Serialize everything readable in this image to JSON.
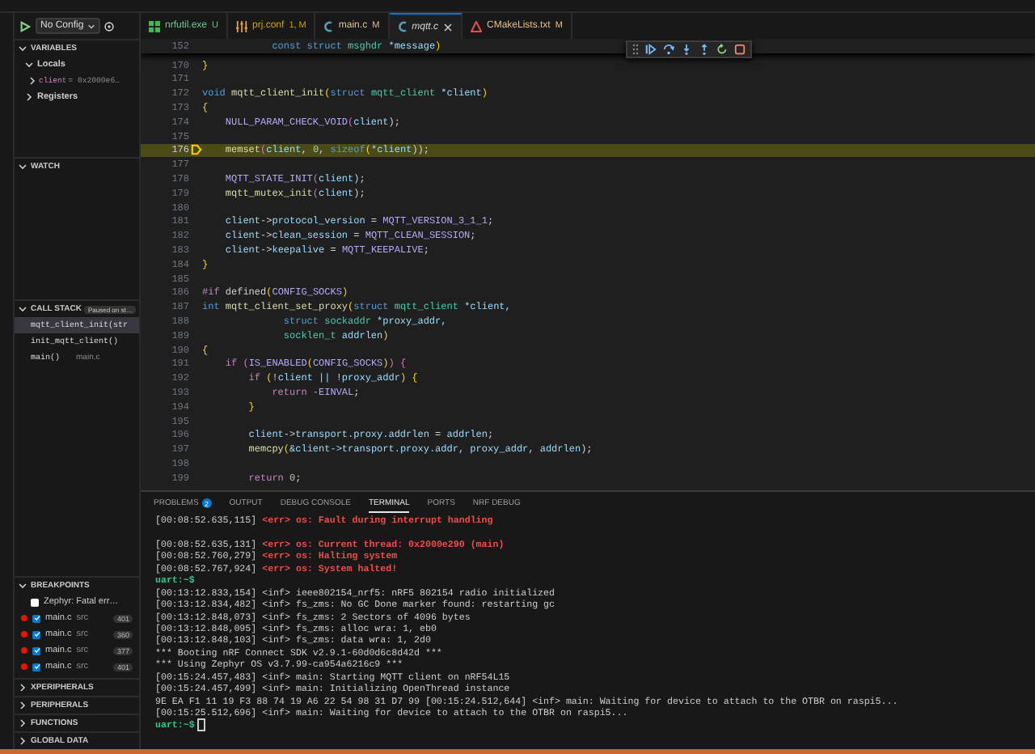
{
  "debug_toolbar": {
    "configuration": "No Config"
  },
  "variables": {
    "title": "VARIABLES",
    "expanded": true,
    "scopes": [
      {
        "label": "Locals",
        "expanded": true,
        "children": [
          {
            "name": "client",
            "value": "= 0x2000e6…",
            "expanded": false
          }
        ]
      },
      {
        "label": "Registers",
        "expanded": false
      }
    ]
  },
  "watch": {
    "title": "WATCH",
    "expanded": true
  },
  "call_stack": {
    "title": "CALL STACK",
    "expanded": true,
    "status": "Paused on st…",
    "frames": [
      {
        "name": "mqtt_client_init(str",
        "selected": true
      },
      {
        "name": "init_mqtt_client()",
        "selected": false
      },
      {
        "name": "main()",
        "source": "main.c",
        "selected": false
      }
    ]
  },
  "breakpoints": {
    "title": "BREAKPOINTS",
    "expanded": true,
    "items": [
      {
        "kind": "exception",
        "label": "Zephyr: Fatal err…",
        "checked": false
      },
      {
        "kind": "line",
        "file": "main.c",
        "folder": "src",
        "line": "401",
        "checked": true
      },
      {
        "kind": "line",
        "file": "main.c",
        "folder": "src",
        "line": "360",
        "checked": true
      },
      {
        "kind": "line",
        "file": "main.c",
        "folder": "src",
        "line": "377",
        "checked": true
      },
      {
        "kind": "line",
        "file": "main.c",
        "folder": "src",
        "line": "401",
        "checked": true
      }
    ]
  },
  "collapsed_sections": [
    {
      "title": "XPERIPHERALS",
      "expanded": false
    },
    {
      "title": "PERIPHERALS",
      "expanded": false
    },
    {
      "title": "FUNCTIONS",
      "expanded": false
    },
    {
      "title": "GLOBAL DATA",
      "expanded": false
    }
  ],
  "tabs": [
    {
      "kind": "windows",
      "label": "nrfutil.exe",
      "badge": "U",
      "color": "#73c991",
      "selected": false
    },
    {
      "kind": "settings",
      "label": "prj.conf",
      "badge": "1, M",
      "color": "#cca700",
      "selected": false
    },
    {
      "kind": "c",
      "label": "main.c",
      "badge": "M",
      "color": "#e2c08d",
      "selected": false
    },
    {
      "kind": "c",
      "label": "mqtt.c",
      "color": "#d4d4d4",
      "selected": true
    },
    {
      "kind": "cmake",
      "label": "CMakeLists.txt",
      "badge": "M",
      "color": "#e2c08d",
      "selected": false
    }
  ],
  "editor": {
    "sticky_line": {
      "number": "152",
      "tokens": [
        {
          "text": "            const struct ",
          "kind": "keyword"
        },
        {
          "text": "msghdr ",
          "kind": "type"
        },
        {
          "text": "*message",
          "kind": "variable"
        },
        {
          "text": ")",
          "kind": "bracket"
        }
      ]
    },
    "lines": [
      {
        "number": "170",
        "current": false,
        "tokens": [
          {
            "text": "}",
            "kind": "bracket"
          }
        ]
      },
      {
        "number": "171",
        "current": false
      },
      {
        "number": "172",
        "current": false,
        "tokens": [
          {
            "text": "void ",
            "kind": "keyword"
          },
          {
            "text": "mqtt_client_init",
            "kind": "function"
          },
          {
            "text": "(",
            "kind": "bracket"
          },
          {
            "text": "struct ",
            "kind": "keyword"
          },
          {
            "text": "mqtt_client ",
            "kind": "type"
          },
          {
            "text": "*client",
            "kind": "variable"
          },
          {
            "text": ")",
            "kind": "bracket"
          }
        ]
      },
      {
        "number": "173",
        "current": false,
        "tokens": [
          {
            "text": "{",
            "kind": "bracket"
          }
        ]
      },
      {
        "number": "174",
        "current": false,
        "tokens": [
          {
            "text": "    NULL_PARAM_CHECK_VOID",
            "kind": "macro"
          },
          {
            "text": "(",
            "kind": "bracket2"
          },
          {
            "text": "client",
            "kind": "variable"
          },
          {
            "text": ");",
            "kind": "plain"
          }
        ]
      },
      {
        "number": "175",
        "current": false
      },
      {
        "number": "176",
        "current": true,
        "tokens": [
          {
            "text": "    memset",
            "kind": "function"
          },
          {
            "text": "(",
            "kind": "bracket2"
          },
          {
            "text": "client",
            "kind": "variable"
          },
          {
            "text": ", ",
            "kind": "plain"
          },
          {
            "text": "0",
            "kind": "number"
          },
          {
            "text": ", ",
            "kind": "plain"
          },
          {
            "text": "sizeof",
            "kind": "keyword"
          },
          {
            "text": "(",
            "kind": "bracket"
          },
          {
            "text": "*client",
            "kind": "variable"
          },
          {
            "text": "));",
            "kind": "plain"
          }
        ]
      },
      {
        "number": "177",
        "current": false
      },
      {
        "number": "178",
        "current": false,
        "tokens": [
          {
            "text": "    MQTT_STATE_INIT",
            "kind": "macro"
          },
          {
            "text": "(",
            "kind": "bracket2"
          },
          {
            "text": "client",
            "kind": "variable"
          },
          {
            "text": ");",
            "kind": "plain"
          }
        ]
      },
      {
        "number": "179",
        "current": false,
        "tokens": [
          {
            "text": "    mqtt_mutex_init",
            "kind": "function"
          },
          {
            "text": "(",
            "kind": "bracket2"
          },
          {
            "text": "client",
            "kind": "variable"
          },
          {
            "text": ");",
            "kind": "plain"
          }
        ]
      },
      {
        "number": "180",
        "current": false
      },
      {
        "number": "181",
        "current": false,
        "tokens": [
          {
            "text": "    client",
            "kind": "variable"
          },
          {
            "text": "->",
            "kind": "plain"
          },
          {
            "text": "protocol_version",
            "kind": "variable"
          },
          {
            "text": " = ",
            "kind": "plain"
          },
          {
            "text": "MQTT_VERSION_3_1_1",
            "kind": "macro"
          },
          {
            "text": ";",
            "kind": "plain"
          }
        ]
      },
      {
        "number": "182",
        "current": false,
        "tokens": [
          {
            "text": "    client",
            "kind": "variable"
          },
          {
            "text": "->",
            "kind": "plain"
          },
          {
            "text": "clean_session",
            "kind": "variable"
          },
          {
            "text": " = ",
            "kind": "plain"
          },
          {
            "text": "MQTT_CLEAN_SESSION",
            "kind": "macro"
          },
          {
            "text": ";",
            "kind": "plain"
          }
        ]
      },
      {
        "number": "183",
        "current": false,
        "tokens": [
          {
            "text": "    client",
            "kind": "variable"
          },
          {
            "text": "->",
            "kind": "plain"
          },
          {
            "text": "keepalive",
            "kind": "variable"
          },
          {
            "text": " = ",
            "kind": "plain"
          },
          {
            "text": "MQTT_KEEPALIVE",
            "kind": "macro"
          },
          {
            "text": ";",
            "kind": "plain"
          }
        ]
      },
      {
        "number": "184",
        "current": false,
        "tokens": [
          {
            "text": "}",
            "kind": "bracket"
          }
        ]
      },
      {
        "number": "185",
        "current": false
      },
      {
        "number": "186",
        "current": false,
        "tokens": [
          {
            "text": "#if ",
            "kind": "control"
          },
          {
            "text": "defined",
            "kind": "plain"
          },
          {
            "text": "(",
            "kind": "bracket"
          },
          {
            "text": "CONFIG_SOCKS",
            "kind": "macro"
          },
          {
            "text": ")",
            "kind": "bracket"
          }
        ]
      },
      {
        "number": "187",
        "current": false,
        "tokens": [
          {
            "text": "int ",
            "kind": "keyword"
          },
          {
            "text": "mqtt_client_set_proxy",
            "kind": "function"
          },
          {
            "text": "(",
            "kind": "bracket"
          },
          {
            "text": "struct ",
            "kind": "keyword"
          },
          {
            "text": "mqtt_client ",
            "kind": "type"
          },
          {
            "text": "*client,",
            "kind": "variable"
          }
        ]
      },
      {
        "number": "188",
        "current": false,
        "tokens": [
          {
            "text": "              struct ",
            "kind": "keyword"
          },
          {
            "text": "sockaddr ",
            "kind": "type"
          },
          {
            "text": "*proxy_addr,",
            "kind": "variable"
          }
        ]
      },
      {
        "number": "189",
        "current": false,
        "tokens": [
          {
            "text": "              socklen_t ",
            "kind": "type"
          },
          {
            "text": "addrlen",
            "kind": "variable"
          },
          {
            "text": ")",
            "kind": "bracket"
          }
        ]
      },
      {
        "number": "190",
        "current": false,
        "tokens": [
          {
            "text": "{",
            "kind": "bracket"
          }
        ]
      },
      {
        "number": "191",
        "current": false,
        "tokens": [
          {
            "text": "    if ",
            "kind": "control"
          },
          {
            "text": "(",
            "kind": "bracket2"
          },
          {
            "text": "IS_ENABLED",
            "kind": "macro"
          },
          {
            "text": "(",
            "kind": "bracket"
          },
          {
            "text": "CONFIG_SOCKS",
            "kind": "macro"
          },
          {
            "text": ")",
            "kind": "bracket"
          },
          {
            "text": ") {",
            "kind": "bracket2"
          }
        ]
      },
      {
        "number": "192",
        "current": false,
        "tokens": [
          {
            "text": "        if ",
            "kind": "control"
          },
          {
            "text": "(",
            "kind": "bracket"
          },
          {
            "text": "!client || !proxy_addr",
            "kind": "variable"
          },
          {
            "text": ") {",
            "kind": "bracket"
          }
        ]
      },
      {
        "number": "193",
        "current": false,
        "tokens": [
          {
            "text": "            return ",
            "kind": "control"
          },
          {
            "text": "-EINVAL",
            "kind": "macro"
          },
          {
            "text": ";",
            "kind": "plain"
          }
        ]
      },
      {
        "number": "194",
        "current": false,
        "tokens": [
          {
            "text": "        }",
            "kind": "bracket"
          }
        ]
      },
      {
        "number": "195",
        "current": false
      },
      {
        "number": "196",
        "current": false,
        "tokens": [
          {
            "text": "        client",
            "kind": "variable"
          },
          {
            "text": "->",
            "kind": "plain"
          },
          {
            "text": "transport.proxy.addrlen",
            "kind": "variable"
          },
          {
            "text": " = ",
            "kind": "plain"
          },
          {
            "text": "addrlen",
            "kind": "variable"
          },
          {
            "text": ";",
            "kind": "plain"
          }
        ]
      },
      {
        "number": "197",
        "current": false,
        "tokens": [
          {
            "text": "        memcpy",
            "kind": "function"
          },
          {
            "text": "(",
            "kind": "bracket"
          },
          {
            "text": "&client->transport.proxy.addr, proxy_addr, addrlen",
            "kind": "variable"
          },
          {
            "text": ");",
            "kind": "plain"
          }
        ]
      },
      {
        "number": "198",
        "current": false
      },
      {
        "number": "199",
        "current": false,
        "tokens": [
          {
            "text": "        return ",
            "kind": "control"
          },
          {
            "text": "0",
            "kind": "number"
          },
          {
            "text": ";",
            "kind": "plain"
          }
        ]
      }
    ]
  },
  "panel": {
    "tabs": [
      {
        "label": "PROBLEMS",
        "badge": "2",
        "selected": false
      },
      {
        "label": "OUTPUT",
        "selected": false
      },
      {
        "label": "DEBUG CONSOLE",
        "selected": false
      },
      {
        "label": "TERMINAL",
        "selected": true
      },
      {
        "label": "PORTS",
        "selected": false
      },
      {
        "label": "NRF DEBUG",
        "selected": false
      }
    ],
    "terminal_lines": [
      {
        "kind": "error",
        "time": "[00:08:52.635,115]",
        "message": "<err> os: Fault during interrupt handling"
      },
      {
        "kind": "blank"
      },
      {
        "kind": "error",
        "time": "[00:08:52.635,131]",
        "message": "<err> os: Current thread: 0x2000e290 (main)"
      },
      {
        "kind": "error",
        "time": "[00:08:52.760,279]",
        "message": "<err> os: Halting system"
      },
      {
        "kind": "error",
        "time": "[00:08:52.767,924]",
        "message": "<err> os: System halted!"
      },
      {
        "kind": "prompt",
        "text": "uart:~$",
        "cursor": false
      },
      {
        "kind": "log",
        "text": "[00:13:12.833,154] <inf> ieee802154_nrf5: nRF5 802154 radio initialized"
      },
      {
        "kind": "log",
        "text": "[00:13:12.834,482] <inf> fs_zms: No GC Done marker found: restarting gc"
      },
      {
        "kind": "log",
        "text": "[00:13:12.848,073] <inf> fs_zms: 2 Sectors of 4096 bytes"
      },
      {
        "kind": "log",
        "text": "[00:13:12.848,095] <inf> fs_zms: alloc wra: 1, eb0"
      },
      {
        "kind": "log",
        "text": "[00:13:12.848,103] <inf> fs_zms: data wra: 1, 2d0"
      },
      {
        "kind": "log",
        "text": "*** Booting nRF Connect SDK v2.9.1-60d0d6c8d42d ***"
      },
      {
        "kind": "log",
        "text": "*** Using Zephyr OS v3.7.99-ca954a6216c9 ***"
      },
      {
        "kind": "log",
        "text": "[00:15:24.457,483] <inf> main: Starting MQTT client on nRF54L15"
      },
      {
        "kind": "log",
        "text": "[00:15:24.457,499] <inf> main: Initializing OpenThread instance"
      },
      {
        "kind": "log",
        "text": "9E EA F1 11 19 F3 88 74 19 A6 22 54 98 31 D7 99 [00:15:24.512,644] <inf> main: Waiting for device to attach to the OTBR on raspi5..."
      },
      {
        "kind": "log",
        "text": "[00:15:25.512,696] <inf> main: Waiting for device to attach to the OTBR on raspi5..."
      },
      {
        "kind": "prompt",
        "text": "uart:~$",
        "cursor": true
      }
    ]
  }
}
